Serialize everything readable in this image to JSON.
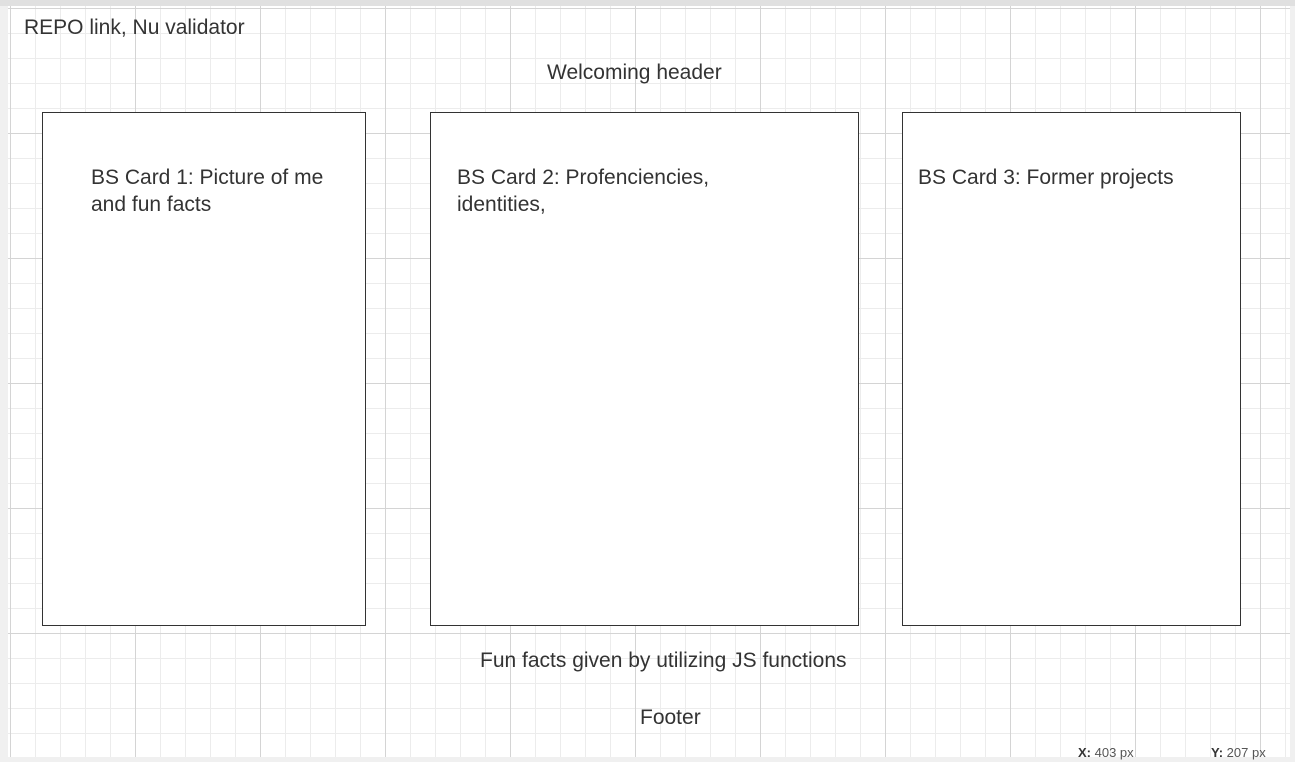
{
  "canvas": {
    "top_left_label": "REPO link, Nu validator",
    "header_label": "Welcoming header",
    "cards": [
      {
        "text": "BS Card 1: Picture of me and fun facts"
      },
      {
        "text": "BS Card 2: Profenciencies, identities,"
      },
      {
        "text": "BS Card 3: Former projects"
      }
    ],
    "fun_facts_label": "Fun facts given by utilizing JS functions",
    "footer_label": "Footer"
  },
  "status": {
    "x_label": "X:",
    "x_value": "403 px",
    "y_label": "Y:",
    "y_value": "207 px"
  }
}
